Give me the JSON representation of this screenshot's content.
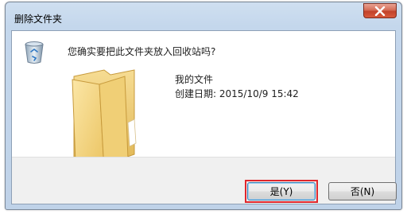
{
  "dialog": {
    "title": "删除文件夹",
    "question": "您确实要把此文件夹放入回收站吗?",
    "item": {
      "name": "我的文件",
      "created_label": "创建日期: ",
      "created_value": "2015/10/9 15:42"
    },
    "buttons": {
      "yes": "是(Y)",
      "no": "否(N)"
    }
  },
  "icons": {
    "close": "close-icon",
    "recycle_bin": "recycle-bin-icon",
    "folder": "folder-icon"
  },
  "colors": {
    "close_button": "#c2422a",
    "highlight_border": "#e0262c",
    "folder": "#f2cc6e"
  }
}
